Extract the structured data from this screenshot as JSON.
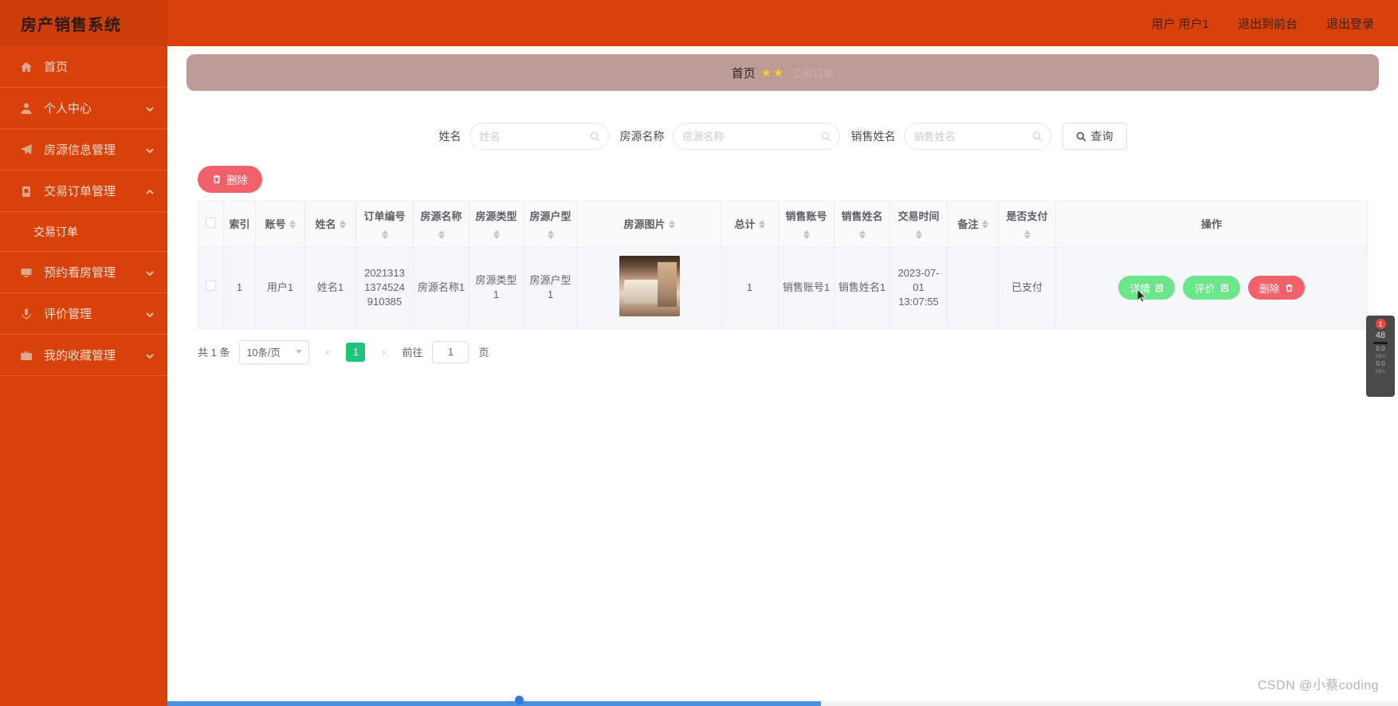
{
  "header": {
    "title": "房产销售系统",
    "user_label": "用户 用户1",
    "exit_front": "退出到前台",
    "logout": "退出登录"
  },
  "sidebar": {
    "items": [
      {
        "label": "首页",
        "icon": "home-icon",
        "has_chevron": false,
        "expanded": false
      },
      {
        "label": "个人中心",
        "icon": "user-icon",
        "has_chevron": true,
        "expanded": false
      },
      {
        "label": "房源信息管理",
        "icon": "paper-plane-icon",
        "has_chevron": true,
        "expanded": false
      },
      {
        "label": "交易订单管理",
        "icon": "clipboard-icon",
        "has_chevron": true,
        "expanded": true
      },
      {
        "label": "预约看房管理",
        "icon": "monitor-icon",
        "has_chevron": true,
        "expanded": false
      },
      {
        "label": "评价管理",
        "icon": "microphone-icon",
        "has_chevron": true,
        "expanded": false
      },
      {
        "label": "我的收藏管理",
        "icon": "briefcase-icon",
        "has_chevron": true,
        "expanded": false
      }
    ],
    "submenu": {
      "label": "交易订单"
    }
  },
  "banner": {
    "title": "首页",
    "stars": "★★",
    "sub": "交易订单"
  },
  "search": {
    "fields": [
      {
        "label": "姓名",
        "placeholder": "姓名",
        "value": ""
      },
      {
        "label": "房源名称",
        "placeholder": "房源名称",
        "value": ""
      },
      {
        "label": "销售姓名",
        "placeholder": "销售姓名",
        "value": ""
      }
    ],
    "query_button": "查询"
  },
  "toolbar": {
    "delete_label": "删除"
  },
  "table": {
    "columns": [
      {
        "label": "",
        "sortable": false,
        "kind": "checkbox"
      },
      {
        "label": "索引",
        "sortable": false
      },
      {
        "label": "账号",
        "sortable": true
      },
      {
        "label": "姓名",
        "sortable": true
      },
      {
        "label": "订单编号",
        "sortable": true
      },
      {
        "label": "房源名称",
        "sortable": true
      },
      {
        "label": "房源类型",
        "sortable": true
      },
      {
        "label": "房源户型",
        "sortable": true
      },
      {
        "label": "房源图片",
        "sortable": true
      },
      {
        "label": "总计",
        "sortable": true
      },
      {
        "label": "销售账号",
        "sortable": true
      },
      {
        "label": "销售姓名",
        "sortable": true
      },
      {
        "label": "交易时间",
        "sortable": true
      },
      {
        "label": "备注",
        "sortable": true
      },
      {
        "label": "是否支付",
        "sortable": true
      },
      {
        "label": "操作",
        "sortable": false
      }
    ],
    "rows": [
      {
        "index": "1",
        "account": "用户1",
        "name": "姓名1",
        "order_no": "2021313 1374524 910385",
        "house_name": "房源名称1",
        "house_type": "房源类型1",
        "house_layout": "房源户型1",
        "image": "bedroom-thumbnail",
        "total": "1",
        "sales_account": "销售账号1",
        "sales_name": "销售姓名1",
        "trade_time": "2023-07-01 13:07:55",
        "remark": "",
        "paid": "已支付",
        "actions": [
          {
            "label": "详情",
            "style": "green",
            "icon": "document-icon"
          },
          {
            "label": "评价",
            "style": "green",
            "icon": "document-icon"
          },
          {
            "label": "删除",
            "style": "red",
            "icon": "trash-icon"
          }
        ]
      }
    ]
  },
  "pagination": {
    "total_text": "共 1 条",
    "page_size": "10条/页",
    "prev": "‹",
    "current_page": "1",
    "next": "›",
    "goto_label": "前往",
    "goto_value": "1",
    "page_unit": "页"
  },
  "float_widget": {
    "badge": "1",
    "fps": "48",
    "net_down": "0.0",
    "net_down_unit": "KB/s",
    "net_up": "0.0",
    "net_up_unit": "KB/s"
  },
  "watermark": "CSDN @小蔡coding",
  "colors": {
    "brand_orange": "#d9410b",
    "banner": "#bd9c97",
    "green_button": "#6ce68a",
    "red_button": "#f0616a",
    "page_active": "#1fc47b"
  }
}
